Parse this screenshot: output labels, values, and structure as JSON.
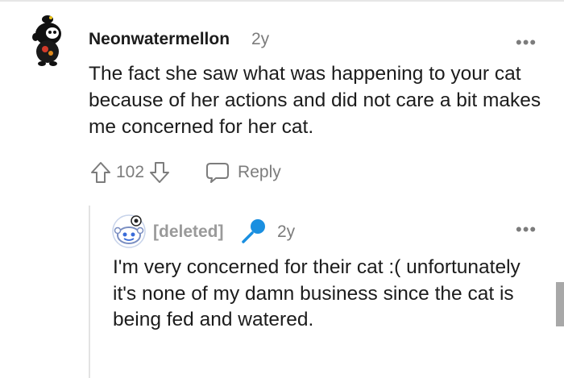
{
  "comment": {
    "author": "Neonwatermellon",
    "time": "2y",
    "body": "The fact she saw what was happening to your cat because of her actions and did not care a bit makes me concerned for her cat.",
    "score": "102",
    "reply_label": "Reply",
    "more_label": "•••"
  },
  "reply": {
    "author": "[deleted]",
    "time": "2y",
    "body": "I'm very concerned for their cat :( unfortunately it's none of my damn business since the cat is being fed and watered.",
    "more_label": "•••"
  },
  "icons": {
    "upvote": "upvote-arrow-icon",
    "downvote": "downvote-arrow-icon",
    "reply": "speech-bubble-icon",
    "mic": "microphone-icon"
  },
  "colors": {
    "meta_text": "#7c7c7c",
    "deleted_text": "#9a9a9a",
    "mic_blue": "#1a8fe0",
    "thread_line": "#e3e3e3"
  }
}
